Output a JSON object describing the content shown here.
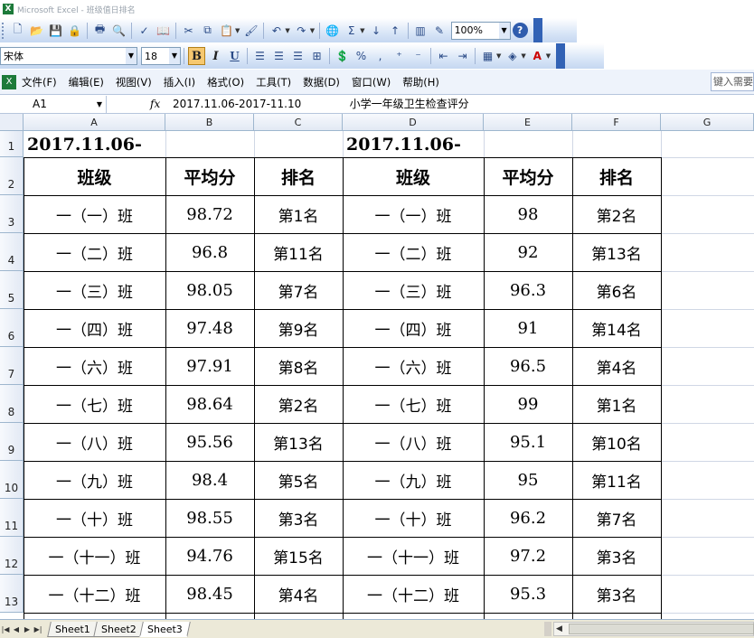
{
  "window": {
    "title": "Microsoft Excel - 班级值日排名"
  },
  "toolbar": {
    "zoom": "100%",
    "font_name": "宋体",
    "font_size": "18",
    "bold": "B",
    "italic": "I",
    "underline": "U",
    "percent": "%",
    "comma": ","
  },
  "menu": {
    "items": [
      "文件(F)",
      "编辑(E)",
      "视图(V)",
      "插入(I)",
      "格式(O)",
      "工具(T)",
      "数据(D)",
      "窗口(W)",
      "帮助(H)"
    ],
    "help_search": "键入需要"
  },
  "formula_bar": {
    "name_box": "A1",
    "fx": "fx",
    "formula": "2017.11.06-2017-11.10              小学一年级卫生检查评分"
  },
  "columns": [
    "A",
    "B",
    "C",
    "D",
    "E",
    "F",
    "G"
  ],
  "rows": [
    "1",
    "2",
    "3",
    "4",
    "5",
    "6",
    "7",
    "8",
    "9",
    "10",
    "11",
    "12",
    "13"
  ],
  "sheet": {
    "title_left": "2017.11.06-",
    "title_right": "2017.11.06-",
    "headers": [
      "班级",
      "平均分",
      "排名",
      "班级",
      "平均分",
      "排名"
    ],
    "data": [
      [
        "一（一）班",
        "98.72",
        "第1名",
        "一（一）班",
        "98",
        "第2名"
      ],
      [
        "一（二）班",
        "96.8",
        "第11名",
        "一（二）班",
        "92",
        "第13名"
      ],
      [
        "一（三）班",
        "98.05",
        "第7名",
        "一（三）班",
        "96.3",
        "第6名"
      ],
      [
        "一（四）班",
        "97.48",
        "第9名",
        "一（四）班",
        "91",
        "第14名"
      ],
      [
        "一（六）班",
        "97.91",
        "第8名",
        "一（六）班",
        "96.5",
        "第4名"
      ],
      [
        "一（七）班",
        "98.64",
        "第2名",
        "一（七）班",
        "99",
        "第1名"
      ],
      [
        "一（八）班",
        "95.56",
        "第13名",
        "一（八）班",
        "95.1",
        "第10名"
      ],
      [
        "一（九）班",
        "98.4",
        "第5名",
        "一（九）班",
        "95",
        "第11名"
      ],
      [
        "一（十）班",
        "98.55",
        "第3名",
        "一（十）班",
        "96.2",
        "第7名"
      ],
      [
        "一（十一）班",
        "94.76",
        "第15名",
        "一（十一）班",
        "97.2",
        "第3名"
      ],
      [
        "一（十二）班",
        "98.45",
        "第4名",
        "一（十二）班",
        "95.3",
        "第3名"
      ]
    ]
  },
  "sheet_tabs": [
    "Sheet1",
    "Sheet2",
    "Sheet3"
  ],
  "active_sheet": "Sheet3",
  "colors": {
    "title_bar": "#ffffff",
    "toolbar": "#d9e6f7",
    "header": "#e2e9f4",
    "gridline": "#d0d7e5"
  }
}
